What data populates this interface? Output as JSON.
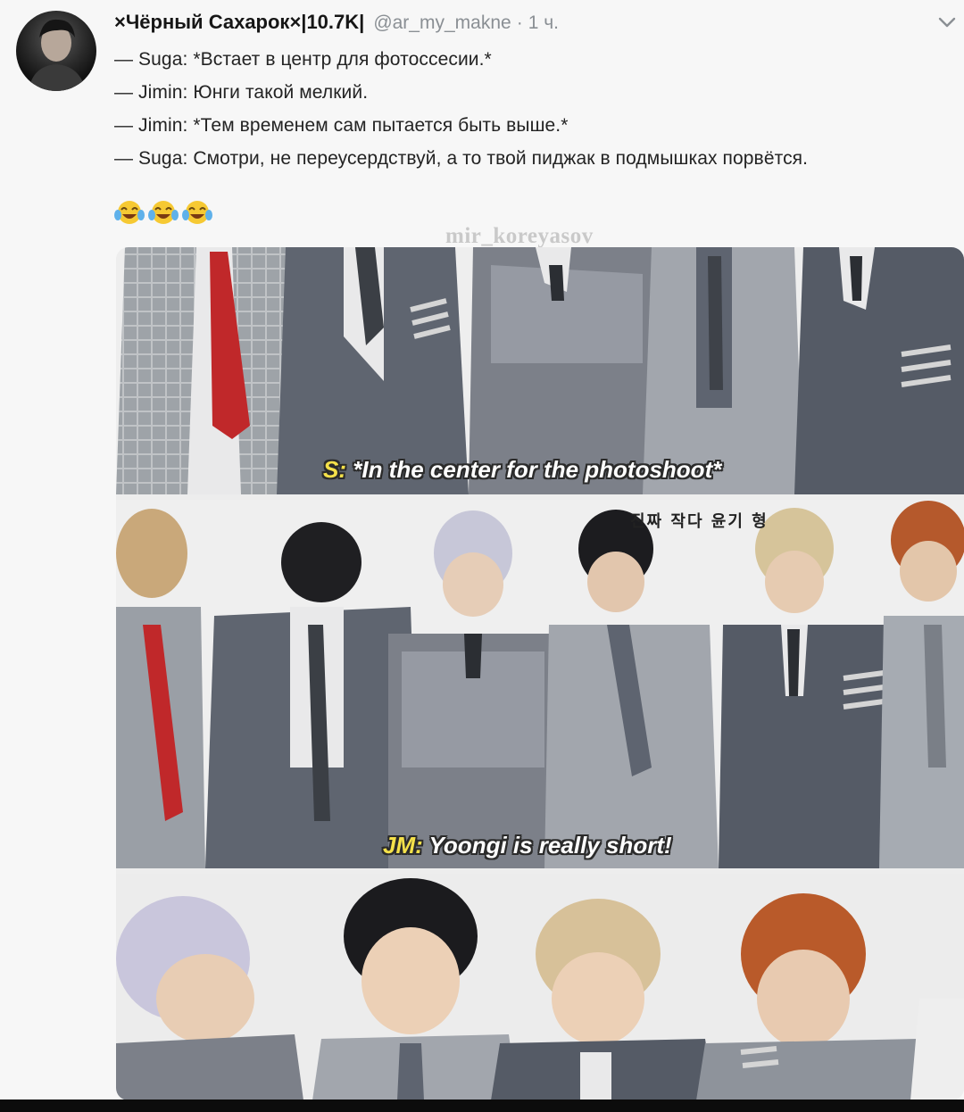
{
  "tweet": {
    "display_name": "×Чёрный Сахарок×|10.7K|",
    "handle": "@ar_my_makne",
    "separator": "·",
    "time": "1 ч.",
    "lines": [
      "— Suga: *Встает в центр для фотоссесии.*",
      "— Jimin: Юнги такой мелкий.",
      "— Jimin: *Тем временем сам пытается быть выше.*",
      "— Suga: Смотри, не переусердствуй, а то твой пиджак в подмышках порвётся."
    ],
    "emojis": [
      "😂",
      "😂",
      "😂"
    ]
  },
  "icons": {
    "avatar": "profile-photo",
    "menu": "chevron-down-icon",
    "emoji": "tears-of-joy-emoji"
  },
  "media": {
    "watermark": "mir_koreyasov",
    "panel1": {
      "speaker": "S:",
      "text": "*In the center for the photoshoot*"
    },
    "panel2": {
      "speaker": "JM:",
      "text": "Yoongi is really short!",
      "korean": "진짜 작다 윤기 형"
    },
    "panel3": {}
  },
  "colors": {
    "suit_gray": "#6d727a",
    "tie_red": "#c0282a",
    "caption_yellow": "#f5e14a"
  }
}
